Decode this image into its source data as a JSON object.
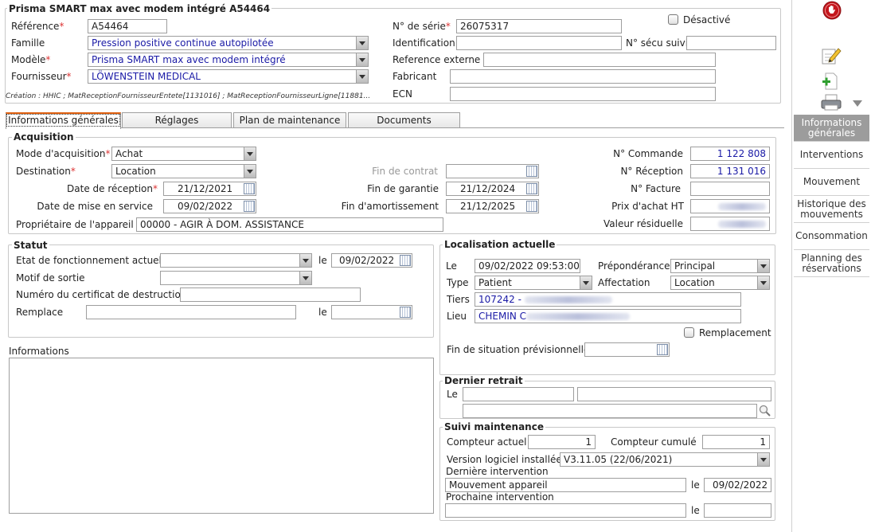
{
  "header": {
    "title": "Prisma SMART max avec modem intégré A54464",
    "reference_label": "Référence",
    "reference_value": "A54464",
    "famille_label": "Famille",
    "famille_value": "Pression positive continue autopilotée",
    "modele_label": "Modèle",
    "modele_value": "Prisma SMART max avec modem intégré",
    "fournisseur_label": "Fournisseur",
    "fournisseur_value": "LÖWENSTEIN MEDICAL",
    "serie_label": "N° de série",
    "serie_value": "26075317",
    "desactive_label": "Désactivé",
    "identification_label": "Identification",
    "identification_value": "",
    "secu_label": "N° sécu suivi",
    "secu_value": "",
    "ref_externe_label": "Reference externe",
    "ref_externe_value": "",
    "fabricant_label": "Fabricant",
    "fabricant_value": "",
    "ecn_label": "ECN",
    "ecn_value": "",
    "creation_text": "Création : HHIC ; MatReceptionFournisseurEntete[1131016] ; MatReceptionFournisseurLigne[11881..."
  },
  "tabs": [
    "Informations générales",
    "Réglages",
    "Plan de maintenance",
    "Documents"
  ],
  "acquisition": {
    "legend": "Acquisition",
    "mode_label": "Mode d'acquisition",
    "mode_value": "Achat",
    "destination_label": "Destination",
    "destination_value": "Location",
    "date_reception_label": "Date de réception",
    "date_reception_value": "21/12/2021",
    "date_service_label": "Date de mise en service",
    "date_service_value": "09/02/2022",
    "proprietaire_label": "Propriétaire de l'appareil",
    "proprietaire_value": "00000 - AGIR À DOM. ASSISTANCE",
    "fin_contrat_label": "Fin de contrat",
    "fin_contrat_value": "",
    "fin_garantie_label": "Fin de garantie",
    "fin_garantie_value": "21/12/2024",
    "fin_amort_label": "Fin d'amortissement",
    "fin_amort_value": "21/12/2025",
    "commande_label": "N° Commande",
    "commande_value": "1 122 808",
    "reception_label": "N° Réception",
    "reception_value": "1 131 016",
    "facture_label": "N° Facture",
    "facture_value": "",
    "prix_label": "Prix d'achat HT",
    "valeur_label": "Valeur résiduelle"
  },
  "statut": {
    "legend": "Statut",
    "etat_label": "Etat de fonctionnement actuel",
    "etat_value": "",
    "le_label": "le",
    "etat_date": "09/02/2022",
    "motif_label": "Motif de sortie",
    "motif_value": "",
    "certificat_label": "Numéro du certificat de destruction",
    "certificat_value": "",
    "remplace_label": "Remplace",
    "remplace_value": "",
    "remplace_date": ""
  },
  "informations": {
    "label": "Informations",
    "value": ""
  },
  "localisation": {
    "legend": "Localisation actuelle",
    "le_label": "Le",
    "le_value": "09/02/2022 09:53:00",
    "preponderance_label": "Prépondérance",
    "preponderance_value": "Principal",
    "type_label": "Type",
    "type_value": "Patient",
    "affectation_label": "Affectation",
    "affectation_value": "Location",
    "tiers_label": "Tiers",
    "tiers_value": "107242 -",
    "lieu_label": "Lieu",
    "lieu_value": "CHEMIN C",
    "remplacement_label": "Remplacement",
    "fin_situation_label": "Fin de situation prévisionnelle",
    "fin_situation_value": ""
  },
  "dernier_retrait": {
    "legend": "Dernier retrait",
    "le_label": "Le"
  },
  "suivi": {
    "legend": "Suivi maintenance",
    "compteur_label": "Compteur actuel",
    "compteur_value": "1",
    "cumule_label": "Compteur cumulé",
    "cumule_value": "1",
    "version_label": "Version logiciel installée",
    "version_value": "V3.11.05 (22/06/2021)",
    "derniere_label": "Dernière intervention",
    "derniere_value": "Mouvement appareil",
    "le_label": "le",
    "derniere_date": "09/02/2022",
    "prochaine_label": "Prochaine intervention",
    "prochaine_value": "",
    "prochaine_date": ""
  },
  "sidebar": {
    "items": [
      "Informations générales",
      "Interventions",
      "Mouvement",
      "Historique des mouvements",
      "Consommation",
      "Planning des réservations"
    ]
  },
  "toolbar": {
    "stop_icon": "stop-hand-icon",
    "edit_icon": "edit-icon",
    "new_icon": "new-document-icon",
    "print_icon": "printer-icon"
  }
}
